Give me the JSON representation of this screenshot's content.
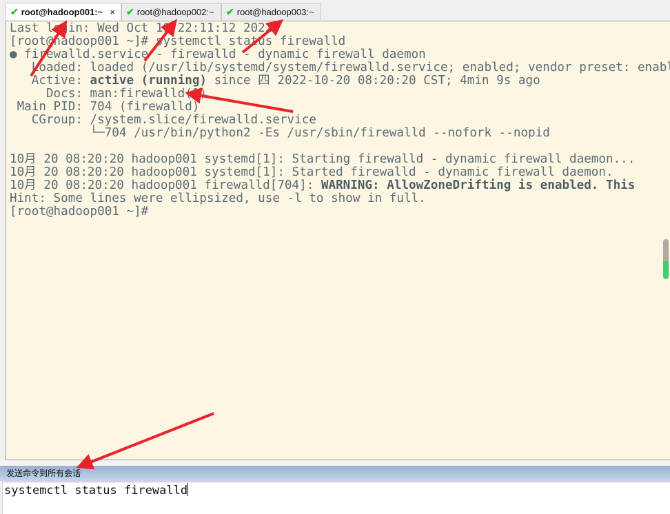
{
  "tabs": [
    {
      "label": "root@hadoop001:~",
      "active": true,
      "status_icon": "check-icon",
      "close": "×"
    },
    {
      "label": "root@hadoop002:~",
      "active": false,
      "status_icon": "check-icon"
    },
    {
      "label": "root@hadoop003:~",
      "active": false,
      "status_icon": "check-icon"
    }
  ],
  "terminal": {
    "lines": [
      "Last login: Wed Oct 19 22:11:12 2022",
      "[root@hadoop001 ~]# systemctl status firewalld",
      "● firewalld.service - firewalld - dynamic firewall daemon",
      "   Loaded: loaded (/usr/lib/systemd/system/firewalld.service; enabled; vendor preset: enabled)",
      {
        "prefix": "   Active: ",
        "bold": "active (running)",
        "suffix": " since 四 2022-10-20 08:20:20 CST; 4min 9s ago"
      },
      "     Docs: man:firewalld(1)",
      " Main PID: 704 (firewalld)",
      "   CGroup: /system.slice/firewalld.service",
      "           └─704 /usr/bin/python2 -Es /usr/sbin/firewalld --nofork --nopid",
      "",
      "10月 20 08:20:20 hadoop001 systemd[1]: Starting firewalld - dynamic firewall daemon...",
      "10月 20 08:20:20 hadoop001 systemd[1]: Started firewalld - dynamic firewall daemon.",
      {
        "prefix": "10月 20 08:20:20 hadoop001 firewalld[704]: ",
        "bold": "WARNING: AllowZoneDrifting is enabled. This",
        "suffix": ""
      },
      "Hint: Some lines were ellipsized, use -l to show in full.",
      "[root@hadoop001 ~]#"
    ],
    "background": "#fdf6e3",
    "scroll_position_percent": 55
  },
  "send_bar": {
    "label": "发送命令到所有会话"
  },
  "command_input": {
    "value": "systemctl status firewalld"
  },
  "annotation_color": "#e8232a"
}
